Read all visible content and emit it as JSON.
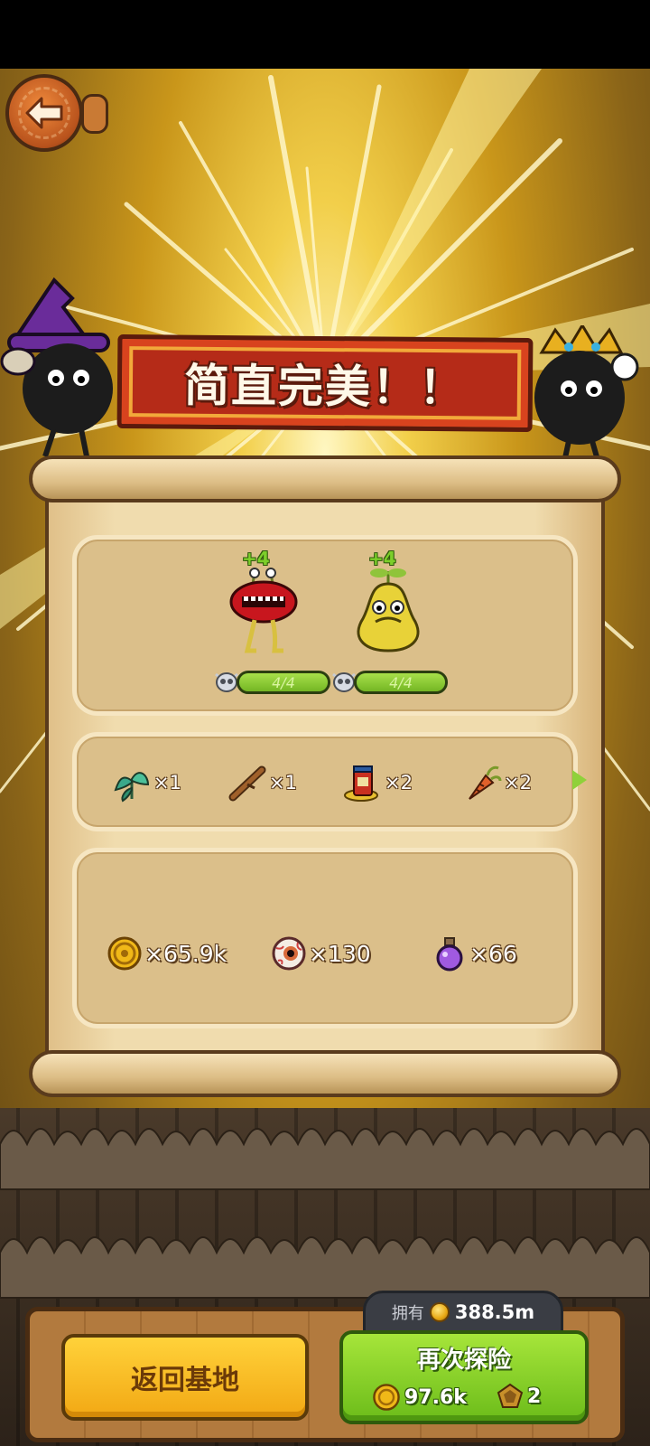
{
  "banner": {
    "title": "简直完美！！"
  },
  "monsters": [
    {
      "name_icon": "red-lips-monster-icon",
      "level_up": "+4",
      "exp_text": "4/4",
      "exp_fraction": 1.0
    },
    {
      "name_icon": "yellow-pear-monster-icon",
      "level_up": "+4",
      "exp_text": "4/4",
      "exp_fraction": 1.0
    }
  ],
  "items": [
    {
      "icon": "green-herb-icon",
      "count": "×1"
    },
    {
      "icon": "wooden-stick-icon",
      "count": "×1"
    },
    {
      "icon": "potion-jar-icon",
      "count": "×2"
    },
    {
      "icon": "carrot-root-icon",
      "count": "×2"
    }
  ],
  "rewards": [
    {
      "icon": "gold-coin-icon",
      "count": "×65.9k"
    },
    {
      "icon": "eyeball-icon",
      "count": "×130"
    },
    {
      "icon": "purple-potion-icon",
      "count": "×66"
    }
  ],
  "owned": {
    "label": "拥有",
    "value": "388.5m"
  },
  "buttons": {
    "return_label": "返回基地",
    "again_label": "再次探险",
    "again_coin_cost": "97.6k",
    "again_gem_cost": "2"
  },
  "colors": {
    "accent_green": "#8fd13a",
    "accent_yellow": "#f2a814",
    "banner_red": "#b52b18"
  }
}
